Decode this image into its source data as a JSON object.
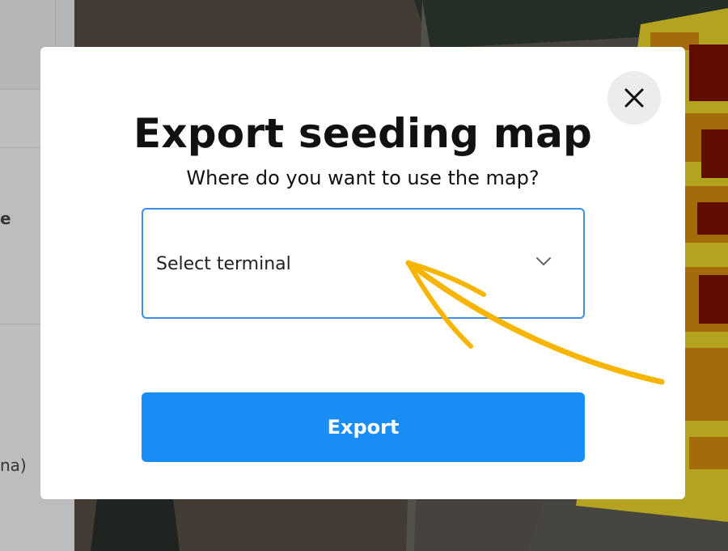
{
  "sidebar": {
    "partial_texts": [
      "e",
      "na)"
    ]
  },
  "modal": {
    "title": "Export seeding map",
    "subtitle": "Where do you want to use the map?",
    "select": {
      "value": "Select terminal"
    },
    "export_label": "Export",
    "close_icon": "close-icon"
  },
  "colors": {
    "accent": "#1a8cf5",
    "select_border": "#3c8ee6",
    "annotation_arrow": "#f7b500",
    "map_high": "#7d0f00",
    "map_mid": "#d4870c",
    "map_low": "#e8d22a"
  }
}
